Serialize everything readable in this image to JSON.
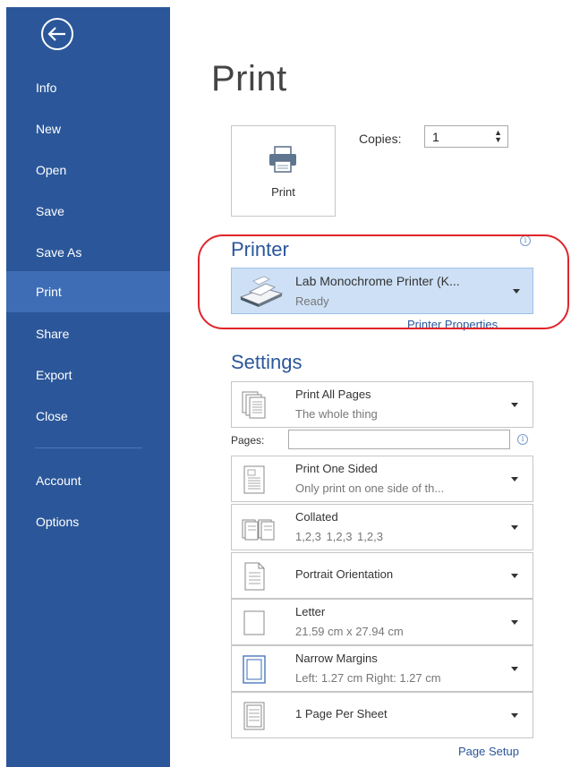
{
  "sidebar": {
    "items": [
      {
        "label": "Info"
      },
      {
        "label": "New"
      },
      {
        "label": "Open"
      },
      {
        "label": "Save"
      },
      {
        "label": "Save As"
      },
      {
        "label": "Print"
      },
      {
        "label": "Share"
      },
      {
        "label": "Export"
      },
      {
        "label": "Close"
      },
      {
        "label": "Account"
      },
      {
        "label": "Options"
      }
    ],
    "active": "Print",
    "bg_color": "#2b579a",
    "active_color": "#3e6db5"
  },
  "main": {
    "title": "Print",
    "print_button_label": "Print",
    "copies_label": "Copies:",
    "copies_value": "1"
  },
  "printer": {
    "heading": "Printer",
    "name": "Lab Monochrome Printer (K...",
    "status": "Ready",
    "properties_link": "Printer Properties"
  },
  "settings": {
    "heading": "Settings",
    "pages_label": "Pages:",
    "pages_value": "",
    "items": [
      {
        "title": "Print All Pages",
        "sub": "The whole thing"
      },
      {
        "title": "Print One Sided",
        "sub": "Only print on one side of th..."
      },
      {
        "title": "Collated",
        "sub": "1,2,3   1,2,3   1,2,3"
      },
      {
        "title": "Portrait Orientation",
        "sub": ""
      },
      {
        "title": "Letter",
        "sub": "21.59 cm x 27.94 cm"
      },
      {
        "title": "Narrow Margins",
        "sub": "Left: 1.27 cm   Right: 1.27 cm"
      },
      {
        "title": "1 Page Per Sheet",
        "sub": ""
      }
    ],
    "page_setup_link": "Page Setup"
  },
  "icons": {
    "back": "back-arrow-icon",
    "info": "info-icon",
    "dropdown": "chevron-down-icon",
    "printer": "printer-icon"
  },
  "colors": {
    "accent": "#2b579a",
    "highlight": "#e0242a",
    "printer_selected_bg": "#cde0f6"
  }
}
